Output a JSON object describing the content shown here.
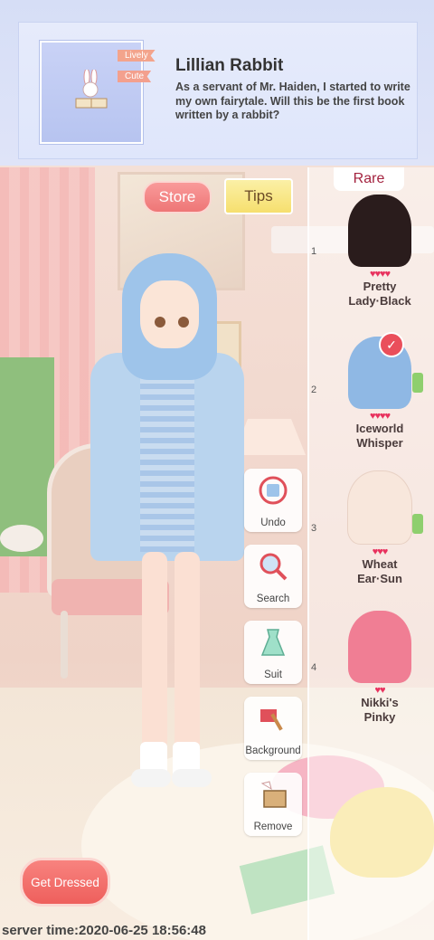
{
  "header": {
    "title": "Lillian Rabbit",
    "description": "As a servant of Mr. Haiden, I started to write my own fairytale. Will this be the first book written by a rabbit?",
    "tags": [
      "Lively",
      "Cute"
    ],
    "thumbnail_icon": "rabbit-with-book-icon"
  },
  "top_buttons": {
    "store": "Store",
    "tips": "Tips"
  },
  "panel": {
    "tab": "Rare",
    "items": [
      {
        "rank": "1",
        "hearts": "♥♥♥♥",
        "name_line1": "Pretty",
        "name_line2": "Lady·Black",
        "hair_color": "#2a1c1c",
        "selected": false
      },
      {
        "rank": "2",
        "hearts": "♥♥♥♥",
        "name_line1": "Iceworld",
        "name_line2": "Whisper",
        "hair_color": "#8fb8e4",
        "selected": true
      },
      {
        "rank": "3",
        "hearts": "♥♥♥",
        "name_line1": "Wheat",
        "name_line2": "Ear·Sun",
        "hair_color": "#f8e7dc",
        "selected": false
      },
      {
        "rank": "4",
        "hearts": "♥♥",
        "name_line1": "Nikki's",
        "name_line2": "Pinky",
        "hair_color": "#f07e94",
        "selected": false
      }
    ]
  },
  "tools": {
    "undo": "Undo",
    "search": "Search",
    "suit": "Suit",
    "background": "Background",
    "remove": "Remove"
  },
  "actions": {
    "get_dressed": "Get Dressed"
  },
  "footer": {
    "server_time": "server time:2020-06-25 18:56:48"
  },
  "colors": {
    "header_bg": "#dfe6fb",
    "accent_red": "#ee5f5c",
    "heart": "#e8325e"
  }
}
